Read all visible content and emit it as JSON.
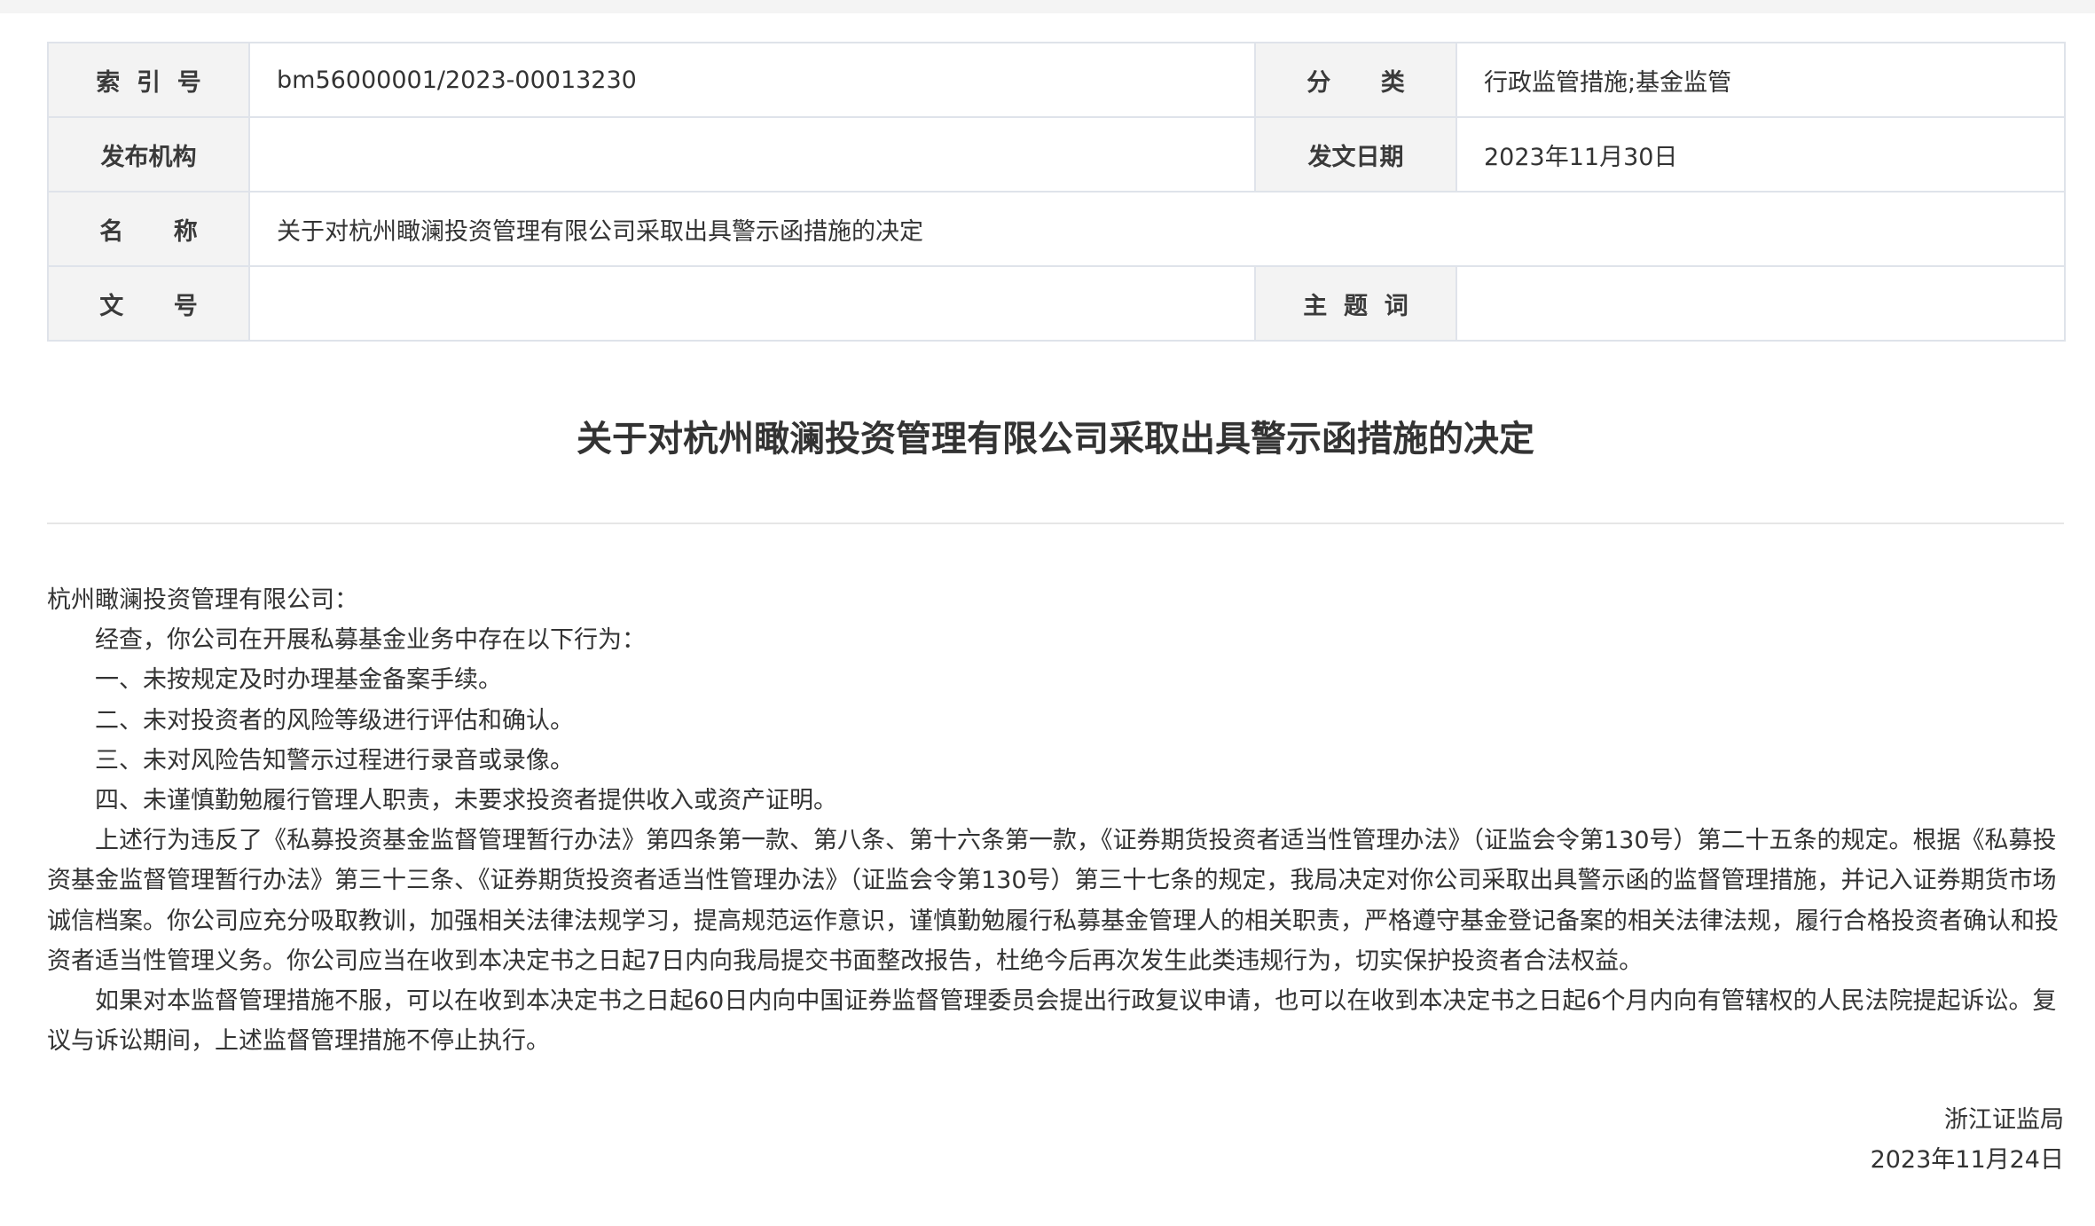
{
  "info_table": {
    "index_label": "索  引  号",
    "index_value": "bm56000001/2023-00013230",
    "category_label": "分      类",
    "category_value": "行政监管措施;基金监管",
    "issuer_label": "发布机构",
    "issuer_value": "",
    "date_label": "发文日期",
    "date_value": "2023年11月30日",
    "name_label": "名      称",
    "name_value": "关于对杭州瞰澜投资管理有限公司采取出具警示函措施的决定",
    "docno_label": "文      号",
    "docno_value": "",
    "keywords_label": "主  题  词",
    "keywords_value": ""
  },
  "document": {
    "title": "关于对杭州瞰澜投资管理有限公司采取出具警示函措施的决定",
    "salutation": "杭州瞰澜投资管理有限公司：",
    "paragraphs": [
      "经查，你公司在开展私募基金业务中存在以下行为：",
      "一、未按规定及时办理基金备案手续。",
      "二、未对投资者的风险等级进行评估和确认。",
      "三、未对风险告知警示过程进行录音或录像。",
      "四、未谨慎勤勉履行管理人职责，未要求投资者提供收入或资产证明。",
      "上述行为违反了《私募投资基金监督管理暂行办法》第四条第一款、第八条、第十六条第一款，《证券期货投资者适当性管理办法》（证监会令第130号）第二十五条的规定。根据《私募投资基金监督管理暂行办法》第三十三条、《证券期货投资者适当性管理办法》（证监会令第130号）第三十七条的规定，我局决定对你公司采取出具警示函的监督管理措施，并记入证券期货市场诚信档案。你公司应充分吸取教训，加强相关法律法规学习，提高规范运作意识，谨慎勤勉履行私募基金管理人的相关职责，严格遵守基金登记备案的相关法律法规，履行合格投资者确认和投资者适当性管理义务。你公司应当在收到本决定书之日起7日内向我局提交书面整改报告，杜绝今后再次发生此类违规行为，切实保护投资者合法权益。",
      "如果对本监督管理措施不服，可以在收到本决定书之日起60日内向中国证券监督管理委员会提出行政复议申请，也可以在收到本决定书之日起6个月内向有管辖权的人民法院提起诉讼。复议与诉讼期间，上述监督管理措施不停止执行。"
    ],
    "signature_org": "浙江证监局",
    "signature_date": "2023年11月24日"
  }
}
